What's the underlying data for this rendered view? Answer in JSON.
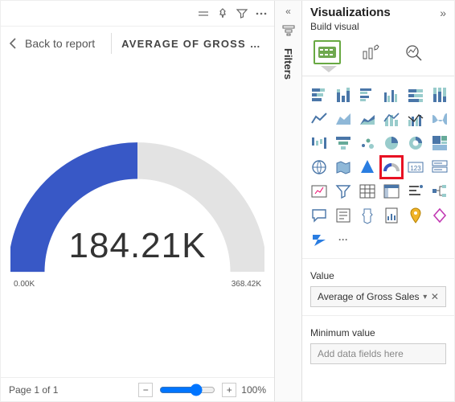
{
  "toolbar": {
    "back_label": "Back to report",
    "report_title": "AVERAGE OF GROSS SAL…"
  },
  "chart_data": {
    "type": "gauge",
    "value_label": "184.21K",
    "min_label": "0.00K",
    "max_label": "368.42K",
    "value": 184.21,
    "min": 0.0,
    "max": 368.42,
    "unit": "K",
    "fill_fraction": 0.5
  },
  "filters": {
    "tab_label": "Filters"
  },
  "viz_panel": {
    "title": "Visualizations",
    "subhead": "Build visual",
    "modes": [
      "build",
      "format",
      "analytics"
    ],
    "value_section_label": "Value",
    "value_field": "Average of Gross Sales",
    "min_section_label": "Minimum value",
    "min_placeholder": "Add data fields here"
  },
  "footer": {
    "page_label": "Page 1 of 1",
    "zoom_label": "100%"
  }
}
